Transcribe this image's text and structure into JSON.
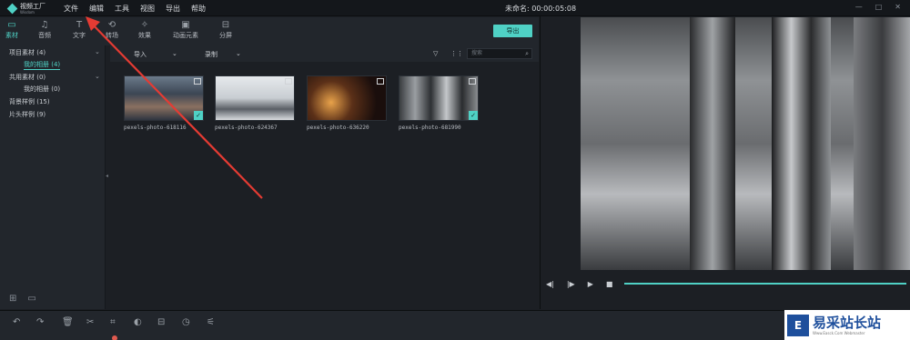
{
  "app": {
    "logo_text": "视频工厂",
    "logo_sub": "Wisdom",
    "project_name": "未命名: 00:00:05:08"
  },
  "menu": [
    "文件",
    "编辑",
    "工具",
    "视图",
    "导出",
    "帮助"
  ],
  "window_controls": [
    "—",
    "□",
    "✕"
  ],
  "tabs": [
    {
      "label": "素材",
      "icon": "folder-icon"
    },
    {
      "label": "音频",
      "icon": "music-icon"
    },
    {
      "label": "文字",
      "icon": "text-icon"
    },
    {
      "label": "转场",
      "icon": "transition-icon"
    },
    {
      "label": "效果",
      "icon": "effects-icon"
    },
    {
      "label": "动画元素",
      "icon": "image-icon"
    },
    {
      "label": "分屏",
      "icon": "split-screen-icon"
    }
  ],
  "export_label": "导出",
  "library": {
    "items": [
      {
        "label": "项目素材 (4)"
      },
      {
        "label": "我的相册 (4)"
      },
      {
        "label": "共用素材 (0)"
      },
      {
        "label": "我的相册 (0)"
      },
      {
        "label": "背景样例 (15)"
      },
      {
        "label": "片头样例 (9)"
      }
    ]
  },
  "media_bar": {
    "import": "导入",
    "record": "录制",
    "search_placeholder": "搜索"
  },
  "media": [
    {
      "name": "pexels-photo-618116",
      "checked": true
    },
    {
      "name": "pexels-photo-624367",
      "checked": false
    },
    {
      "name": "pexels-photo-636220",
      "checked": false
    },
    {
      "name": "pexels-photo-681990",
      "checked": true
    }
  ],
  "watermark": {
    "logo": "E",
    "main": "易采站长站",
    "sub": "Www.Easck.Com Webmaster"
  }
}
